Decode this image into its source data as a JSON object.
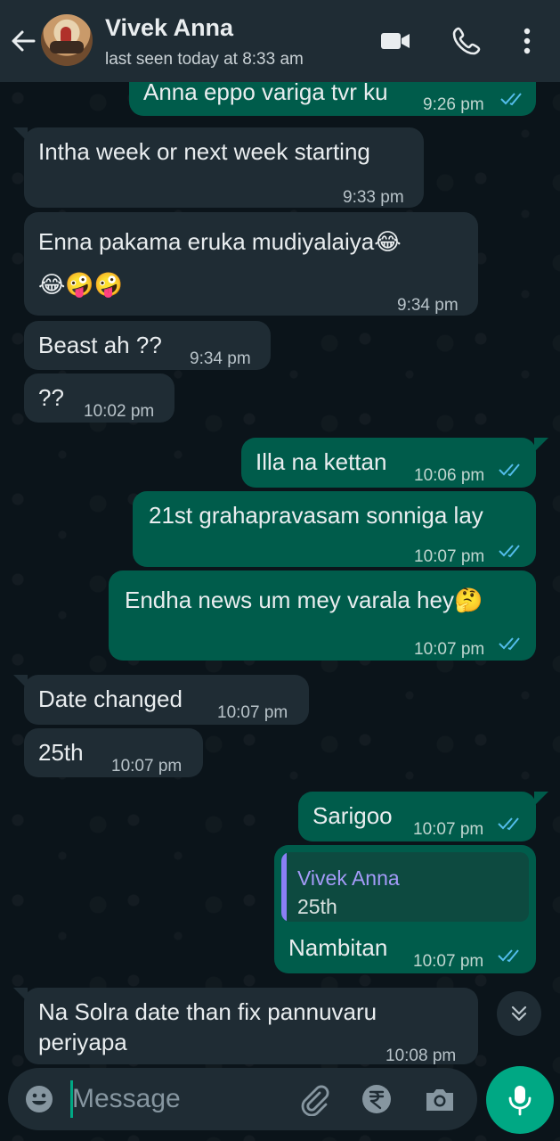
{
  "header": {
    "contact_name": "Vivek Anna",
    "status": "last seen today at 8:33 am"
  },
  "messages": [
    {
      "direction": "out",
      "text": "Anna eppo variga tvr ku",
      "time": "9:26 pm",
      "read": true
    },
    {
      "direction": "in",
      "text": "Intha week or next week starting",
      "time": "9:33 pm"
    },
    {
      "direction": "in",
      "text": "Enna pakama eruka mudiyalaiya😂",
      "text2": "😂🤪🤪",
      "time": "9:34 pm"
    },
    {
      "direction": "in",
      "text": "Beast ah ??",
      "time": "9:34 pm"
    },
    {
      "direction": "in",
      "text": "??",
      "time": "10:02 pm"
    },
    {
      "direction": "out",
      "text": "Illa na kettan",
      "time": "10:06 pm",
      "read": true
    },
    {
      "direction": "out",
      "text": "21st grahapravasam sonniga lay",
      "time": "10:07 pm",
      "read": true
    },
    {
      "direction": "out",
      "text": "Endha news um mey varala hey🤔",
      "time": "10:07 pm",
      "read": true
    },
    {
      "direction": "in",
      "text": "Date changed",
      "time": "10:07 pm"
    },
    {
      "direction": "in",
      "text": "25th",
      "time": "10:07 pm"
    },
    {
      "direction": "out",
      "text": "Sarigoo",
      "time": "10:07 pm",
      "read": true
    },
    {
      "direction": "out",
      "text": "Nambitan",
      "time": "10:07 pm",
      "read": true,
      "reply_to": {
        "name": "Vivek Anna",
        "text": "25th"
      }
    },
    {
      "direction": "in",
      "text": "Na Solra date than fix pannuvaru",
      "text2": "periyapa",
      "time": "10:08 pm"
    }
  ],
  "composer": {
    "placeholder": "Message"
  },
  "colors": {
    "background": "#0b141a",
    "header": "#1f2c34",
    "incoming_bubble": "#1f2c34",
    "outgoing_bubble": "#005c4b",
    "accent": "#00a884",
    "read_tick": "#53bdeb",
    "quote_name": "#a49bf8"
  },
  "icons": [
    "back-arrow-icon",
    "video-call-icon",
    "phone-icon",
    "more-options-icon",
    "double-tick-icon",
    "scroll-down-icon",
    "emoji-icon",
    "attach-icon",
    "rupee-payment-icon",
    "camera-icon",
    "mic-icon"
  ]
}
